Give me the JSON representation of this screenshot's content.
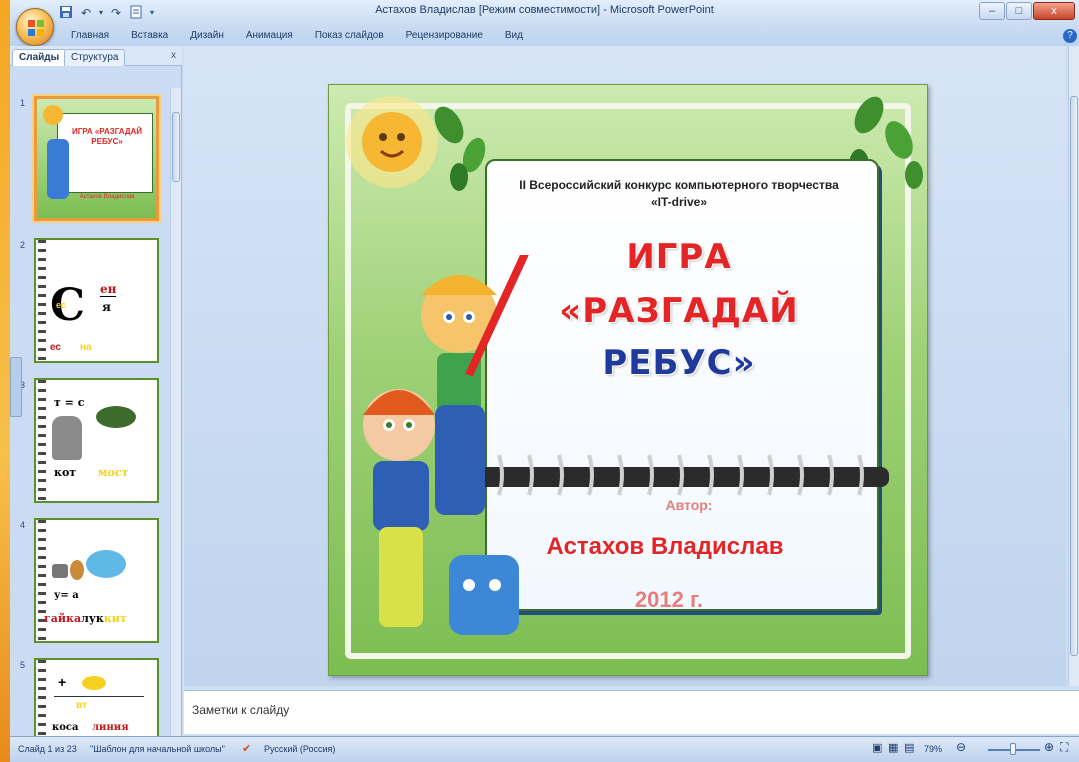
{
  "window": {
    "title": "Астахов Владислав [Режим совместимости] - Microsoft PowerPoint",
    "controls": [
      "–",
      "□",
      "x"
    ]
  },
  "ribbon": {
    "tabs": [
      "Главная",
      "Вставка",
      "Дизайн",
      "Анимация",
      "Показ слайдов",
      "Рецензирование",
      "Вид"
    ],
    "help": "?"
  },
  "pane": {
    "tabs": [
      "Слайды",
      "Структура"
    ],
    "close": "x",
    "thumbnails": [
      {
        "num": "1",
        "title": "ИГРА «РАЗГАДАЙ РЕБУС»",
        "author": "Астахов Владислав"
      },
      {
        "num": "2",
        "a": "ен",
        "b": "я",
        "c": "ес",
        "d": "на"
      },
      {
        "num": "3",
        "a": "т = с",
        "b": "кот",
        "c": "мост"
      },
      {
        "num": "4",
        "a": "у= а",
        "b": "гайка",
        "c": "лук",
        "d": "кит"
      },
      {
        "num": "5",
        "a": "+",
        "b": "вт",
        "c": "коса",
        "d": "линия"
      }
    ]
  },
  "slide": {
    "contest": "II Всероссийский  конкурс компьютерного творчества",
    "contest_name": "«IT-drive»",
    "title_line1": "ИГРА",
    "title_line2": "«РАЗГАДАЙ",
    "title_line3": "РЕБУС»",
    "author_label": "Автор:",
    "author_name": "Астахов Владислав",
    "year": "2012 г."
  },
  "notes": {
    "placeholder": "Заметки к слайду"
  },
  "status": {
    "slide": "Слайд 1 из 23",
    "theme": "\"Шаблон для начальной школы\"",
    "language": "Русский (Россия)",
    "zoom": "79%"
  },
  "colors": {
    "accent": "#e42525",
    "title_blue": "#1f3a9a",
    "frame_green": "#7cbd52"
  }
}
